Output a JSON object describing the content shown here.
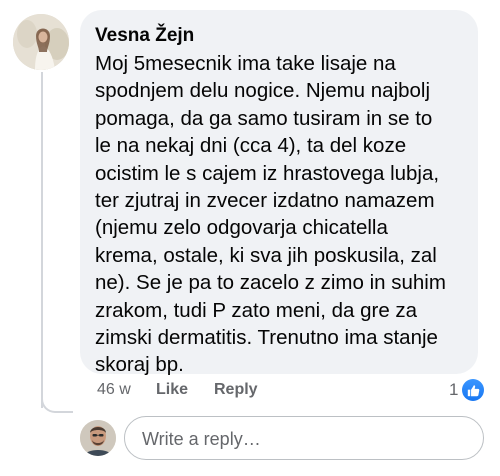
{
  "comment": {
    "author": "Vesna Žejn",
    "text_lines": [
      "Moj 5mesecnik ima take lisaje na",
      "spodnjem delu nogice. Njemu najbolj",
      "pomaga, da ga samo tusiram in se to",
      "le na nekaj dni (cca 4), ta del koze",
      "ocistim le s cajem iz hrastovega lubja,",
      "ter zjutraj in zvecer izdatno namazem",
      "(njemu zelo odgovarja chicatella",
      "krema, ostale, ki sva jih poskusila, zal",
      "ne). Se je pa to zacelo z zimo in suhim",
      "zrakom, tudi P zato meni, da gre za",
      "zimski dermatitis. Trenutno ima stanje",
      "skoraj bp."
    ],
    "timestamp": "46 w",
    "like_label": "Like",
    "reply_label": "Reply",
    "reaction_count": "1",
    "reaction_icon": "like-thumbs-up-icon",
    "reaction_color": "#1877f2"
  },
  "reply_box": {
    "placeholder": "Write a reply…"
  },
  "colors": {
    "bubble": "#f0f2f5",
    "text": "#050505",
    "secondary_text": "#65676b"
  }
}
